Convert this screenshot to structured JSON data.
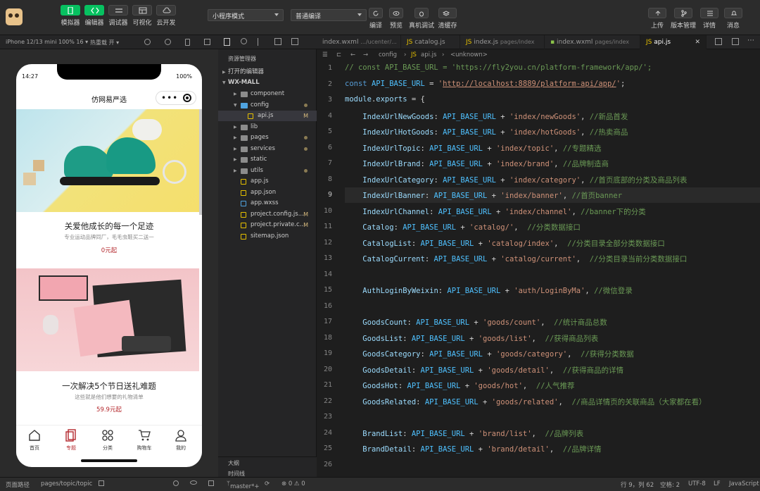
{
  "toolbar": {
    "simulator": "模拟器",
    "editor": "编辑器",
    "debugger": "调试器",
    "visual": "可视化",
    "cloud": "云开发",
    "mode": "小程序模式",
    "compile_mode": "普通编译",
    "compile": "编译",
    "preview": "预览",
    "device_debug": "真机调试",
    "clear_cache": "清缓存",
    "upload": "上传",
    "version": "版本管理",
    "details": "详情",
    "messages": "消息"
  },
  "sim_bar": {
    "device": "iPhone 12/13 mini 100% 16 ▾",
    "hot": "热重载 开 ▾"
  },
  "phone": {
    "time": "14:27",
    "battery": "100%",
    "nav_title": "仿网易严选",
    "topics": [
      {
        "title": "关爱他成长的每一个足迹",
        "subtitle": "专业运动品牌同厂，毛毛虫鞋买二送一",
        "price": "0元起"
      },
      {
        "title": "一次解决5个节日送礼难题",
        "subtitle": "这些就是他们想要的礼物清单",
        "price": "59.9元起"
      }
    ],
    "tabs": [
      "首页",
      "专题",
      "分类",
      "购物车",
      "我的"
    ]
  },
  "explorer": {
    "header": "资源管理器",
    "open_editors": "打开的编辑器",
    "project": "WX-MALL",
    "items": [
      {
        "name": "component",
        "type": "folder",
        "mark": ""
      },
      {
        "name": "config",
        "type": "folder",
        "mark": "dot"
      },
      {
        "name": "api.js",
        "type": "js",
        "mark": "M"
      },
      {
        "name": "lib",
        "type": "folder",
        "mark": ""
      },
      {
        "name": "pages",
        "type": "folder",
        "mark": "dot"
      },
      {
        "name": "services",
        "type": "folder",
        "mark": "dot"
      },
      {
        "name": "static",
        "type": "folder",
        "mark": ""
      },
      {
        "name": "utils",
        "type": "folder",
        "mark": "dot"
      },
      {
        "name": "app.js",
        "type": "js",
        "mark": ""
      },
      {
        "name": "app.json",
        "type": "json",
        "mark": ""
      },
      {
        "name": "app.wxss",
        "type": "css",
        "mark": ""
      },
      {
        "name": "project.config.js...",
        "type": "json",
        "mark": "M"
      },
      {
        "name": "project.private.c...",
        "type": "json",
        "mark": "M"
      },
      {
        "name": "sitemap.json",
        "type": "json",
        "mark": ""
      }
    ],
    "outline": "大纲",
    "timeline": "时间线"
  },
  "tabs": [
    {
      "name": "index.wxml",
      "path": ".../ucenter/..."
    },
    {
      "name": "catalog.js",
      "path": ""
    },
    {
      "name": "index.js",
      "path": "pages/index"
    },
    {
      "name": "index.wxml",
      "path": "pages/index"
    },
    {
      "name": "api.js",
      "path": ""
    }
  ],
  "breadcrumb": {
    "folder": "config",
    "file": "api.js",
    "symbol": "<unknown>"
  },
  "code": [
    {
      "n": "1",
      "t": "// const API_BASE_URL = 'https://fly2you.cn/platform-framework/app/';"
    },
    {
      "n": "2",
      "t": "const API_BASE_URL = 'http://localhost:8889/platform-api/app/';"
    },
    {
      "n": "3",
      "t": "module.exports = {"
    },
    {
      "n": "4",
      "t": "    IndexUrlNewGoods: API_BASE_URL + 'index/newGoods', //新品首发"
    },
    {
      "n": "5",
      "t": "    IndexUrlHotGoods: API_BASE_URL + 'index/hotGoods', //热卖商品"
    },
    {
      "n": "6",
      "t": "    IndexUrlTopic: API_BASE_URL + 'index/topic', //专题精选"
    },
    {
      "n": "7",
      "t": "    IndexUrlBrand: API_BASE_URL + 'index/brand', //品牌制造商"
    },
    {
      "n": "8",
      "t": "    IndexUrlCategory: API_BASE_URL + 'index/category', //首页底部的分类及商品列表"
    },
    {
      "n": "9",
      "t": "    IndexUrlBanner: API_BASE_URL + 'index/banner', //首页banner"
    },
    {
      "n": "10",
      "t": "    IndexUrlChannel: API_BASE_URL + 'index/channel', //banner下的分类"
    },
    {
      "n": "11",
      "t": "    Catalog: API_BASE_URL + 'catalog/',  //分类数据接口"
    },
    {
      "n": "12",
      "t": "    CatalogList: API_BASE_URL + 'catalog/index',  //分类目录全部分类数据接口"
    },
    {
      "n": "13",
      "t": "    CatalogCurrent: API_BASE_URL + 'catalog/current',  //分类目录当前分类数据接口"
    },
    {
      "n": "14",
      "t": ""
    },
    {
      "n": "15",
      "t": "    AuthLoginByWeixin: API_BASE_URL + 'auth/LoginByMa', //微信登录"
    },
    {
      "n": "16",
      "t": ""
    },
    {
      "n": "17",
      "t": "    GoodsCount: API_BASE_URL + 'goods/count',  //统计商品总数"
    },
    {
      "n": "18",
      "t": "    GoodsList: API_BASE_URL + 'goods/list',  //获得商品列表"
    },
    {
      "n": "19",
      "t": "    GoodsCategory: API_BASE_URL + 'goods/category',  //获得分类数据"
    },
    {
      "n": "20",
      "t": "    GoodsDetail: API_BASE_URL + 'goods/detail',  //获得商品的详情"
    },
    {
      "n": "21",
      "t": "    GoodsHot: API_BASE_URL + 'goods/hot',  //人气推荐"
    },
    {
      "n": "22",
      "t": "    GoodsRelated: API_BASE_URL + 'goods/related',  //商品详情页的关联商品（大家都在看）"
    },
    {
      "n": "23",
      "t": ""
    },
    {
      "n": "24",
      "t": "    BrandList: API_BASE_URL + 'brand/list',  //品牌列表"
    },
    {
      "n": "25",
      "t": "    BrandDetail: API_BASE_URL + 'brand/detail',  //品牌详情"
    },
    {
      "n": "26",
      "t": ""
    }
  ],
  "status": {
    "page_path_label": "页面路径",
    "page_path": "pages/topic/topic",
    "branch": "master*+",
    "errors": "⊗ 0 ⚠ 0",
    "cursor": "行 9，列 62",
    "spaces": "空格: 2",
    "encoding": "UTF-8",
    "eol": "LF",
    "lang": "JavaScript"
  },
  "colors": {
    "green": "#07c160",
    "brand_red": "#b4282d"
  }
}
